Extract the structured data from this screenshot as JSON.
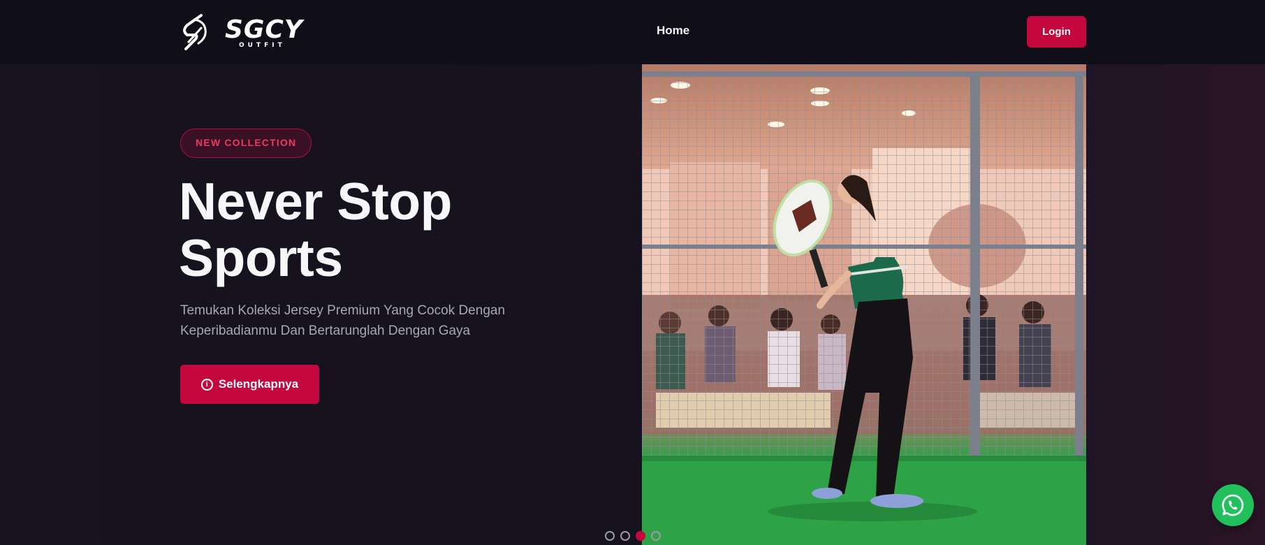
{
  "brand": {
    "name": "SGCY",
    "tagline": "OUTFIT",
    "logo_icon": "sgcy-emblem-icon"
  },
  "nav": {
    "items": [
      {
        "label": "Home"
      }
    ],
    "login_label": "Login"
  },
  "hero": {
    "badge": "NEW COLLECTION",
    "title_line1": "Never Stop",
    "title_line2": "Sports",
    "description": "Temukan Koleksi Jersey Premium Yang Cocok Dengan Keperibadianmu Dan Bertarunglah Dengan Gaya",
    "cta_label": "Selengkapnya",
    "cta_icon": "info-icon",
    "image": "padel-player-photo"
  },
  "carousel": {
    "total_slides": 4,
    "active_slide": 3
  },
  "floating": {
    "whatsapp_icon": "whatsapp-icon"
  },
  "colors": {
    "accent": "#c4073c",
    "background": "#15121f",
    "header": "#100e18",
    "whatsapp": "#21c05c"
  }
}
